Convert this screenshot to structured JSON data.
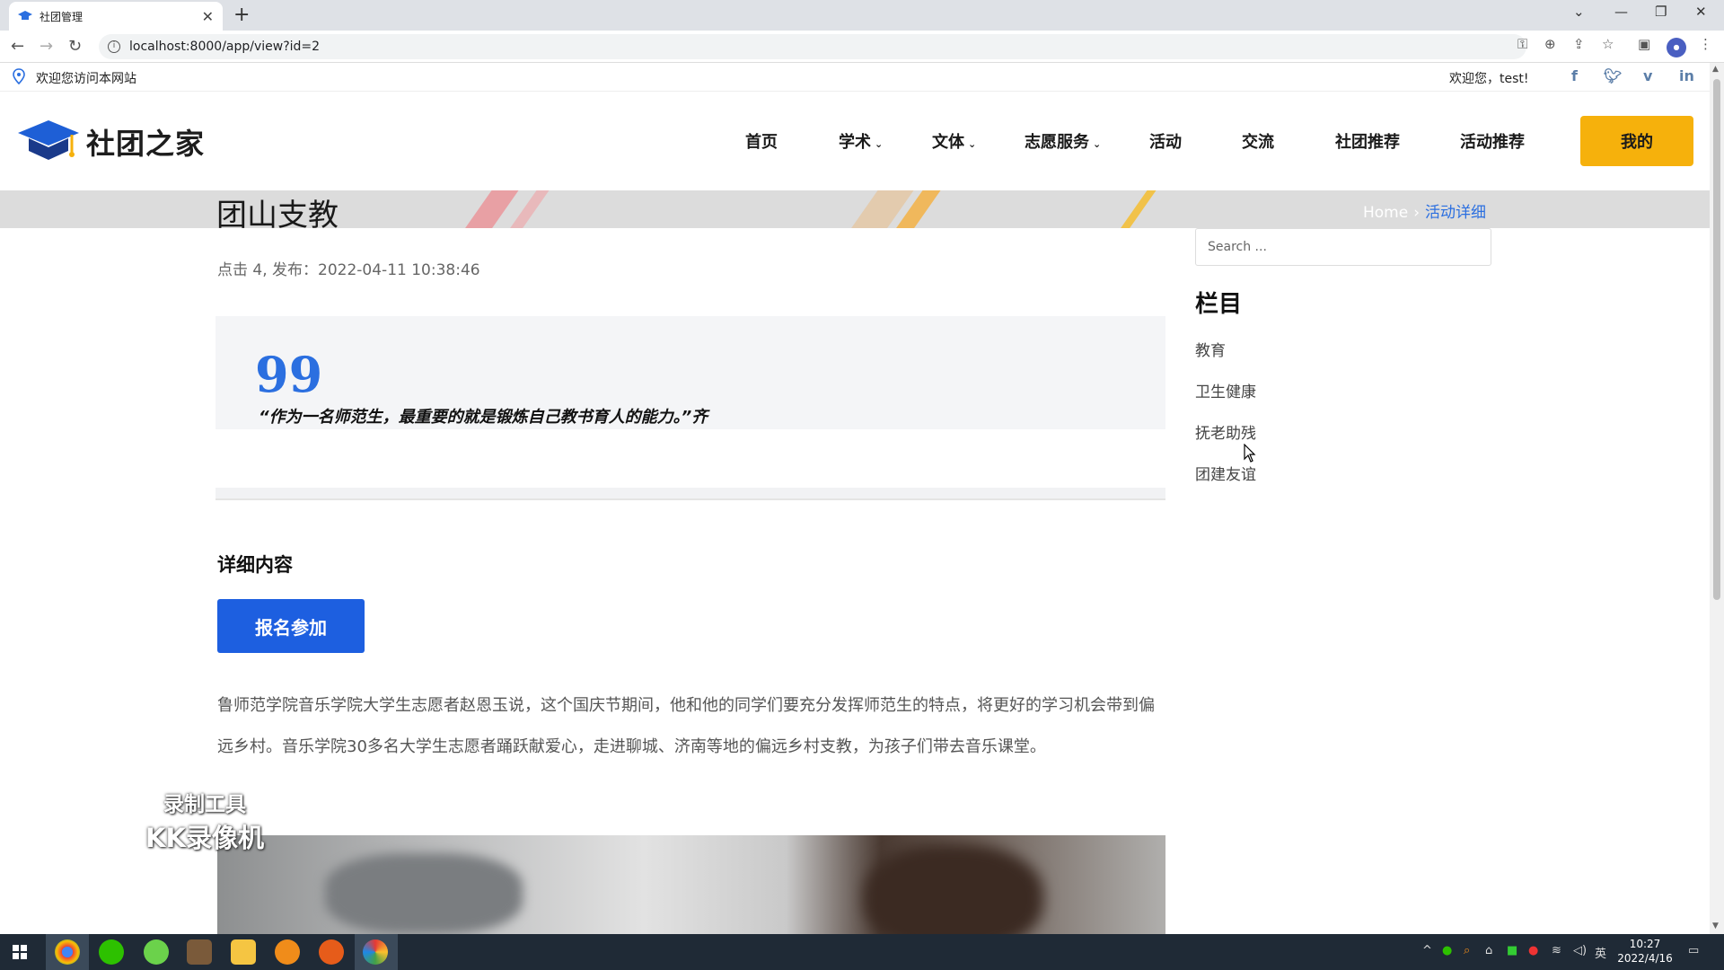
{
  "browser": {
    "tab_title": "社团管理",
    "url": "localhost:8000/app/view?id=2"
  },
  "topbar": {
    "site_welcome": "欢迎您访问本网站",
    "user_greeting": "欢迎您，test!"
  },
  "header": {
    "logo_text": "社团之家",
    "menu": {
      "home": "首页",
      "academic": "学术",
      "culture_sports": "文体",
      "volunteer": "志愿服务",
      "activities": "活动",
      "exchange": "交流",
      "club_recommend": "社团推荐",
      "activity_recommend": "活动推荐"
    },
    "mine_label": "我的"
  },
  "banner": {
    "title": "团山支教",
    "breadcrumb_home": "Home",
    "breadcrumb_current": "活动详细"
  },
  "article": {
    "meta": "点击 4, 发布：2022-04-11 10:38:46",
    "quote": "“作为一名师范生，最重要的就是锻炼自己教书育人的能力。”齐",
    "section_title": "详细内容",
    "signup_label": "报名参加",
    "body": "鲁师范学院音乐学院大学生志愿者赵恩玉说，这个国庆节期间，他和他的同学们要充分发挥师范生的特点，将更好的学习机会带到偏远乡村。音乐学院30多名大学生志愿者踊跃献爱心，走进聊城、济南等地的偏远乡村支教，为孩子们带去音乐课堂。"
  },
  "sidebar": {
    "search_placeholder": "Search ...",
    "categories_title": "栏目",
    "categories": [
      "教育",
      "卫生健康",
      "抚老助残",
      "团建友谊"
    ]
  },
  "watermark": {
    "line1": "录制工具",
    "line2": "KK录像机"
  },
  "taskbar": {
    "time": "10:27",
    "date": "2022/4/16",
    "ime": "英"
  },
  "colors": {
    "accent_blue": "#1d5fe0",
    "accent_yellow": "#f6b10c"
  }
}
